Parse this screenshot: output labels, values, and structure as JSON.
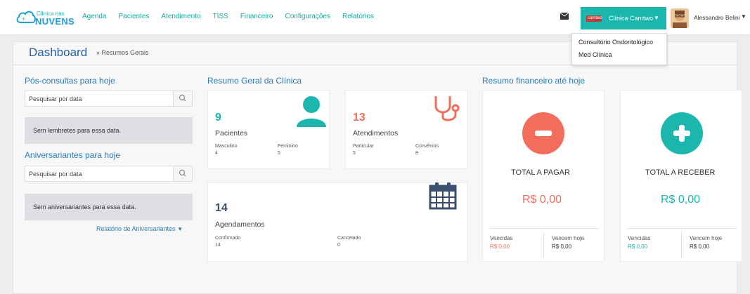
{
  "brand": {
    "top": "Clínica nas",
    "bottom": "NUVENS"
  },
  "nav": [
    "Agenda",
    "Pacientes",
    "Atendimento",
    "TISS",
    "Financeiro",
    "Configurações",
    "Relatórios"
  ],
  "clinic": {
    "name": "Clínica Camtwo",
    "logo_text": "camtwo"
  },
  "user": {
    "name": "Alessandro Belini"
  },
  "dropdown": [
    "Consultório Ondontológico",
    "Med Clínica"
  ],
  "page": {
    "title": "Dashboard",
    "breadcrumb": "» Resumos Gerais"
  },
  "left": {
    "pos_title": "Pós-consultas para hoje",
    "pos_placeholder": "Pesquisar por data",
    "pos_empty": "Sem lembretes para essa data.",
    "aniv_title": "Aniversariantes para hoje",
    "aniv_placeholder": "Pesquisar por data",
    "aniv_empty": "Sem aniversariantes para essa data.",
    "report_link": "Relatório de Aniversariantes"
  },
  "summary": {
    "title": "Resumo Geral da Clínica",
    "patients": {
      "count": "9",
      "label": "Pacientes",
      "a_label": "Masculino",
      "a_value": "4",
      "b_label": "Feminino",
      "b_value": "5"
    },
    "visits": {
      "count": "13",
      "label": "Atendimentos",
      "a_label": "Particular",
      "a_value": "5",
      "b_label": "Convênios",
      "b_value": "8"
    },
    "appointments": {
      "count": "14",
      "label": "Agendamentos",
      "a_label": "Confirmado",
      "a_value": "14",
      "b_label": "Cancelado",
      "b_value": "0"
    }
  },
  "finance": {
    "title": "Resumo financeiro até hoje",
    "pay": {
      "title": "TOTAL A PAGAR",
      "value": "R$ 0,00",
      "a_label": "Vencidas",
      "a_value": "R$ 0,00",
      "b_label": "Vencem hoje",
      "b_value": "R$ 0,00"
    },
    "receive": {
      "title": "TOTAL A RECEBER",
      "value": "R$ 0,00",
      "a_label": "Vencidas",
      "a_value": "R$ 0,00",
      "b_label": "Vencem hoje",
      "b_value": "R$ 0,00"
    }
  },
  "colors": {
    "teal": "#1bb6ad",
    "salmon": "#f26d5b",
    "navy": "#3d4f6e",
    "blue": "#2a7cbc"
  }
}
